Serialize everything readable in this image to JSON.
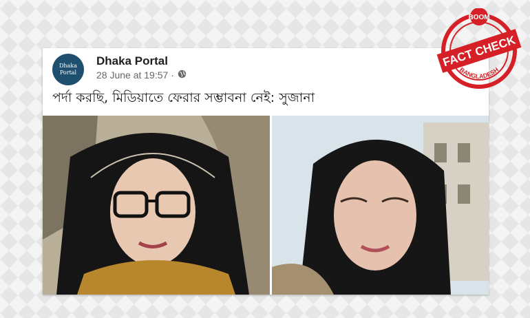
{
  "post": {
    "page_name": "Dhaka Portal",
    "timestamp": "28 June at 19:57 ·",
    "caption": "পর্দা করছি, মিডিয়াতে ফেরার সম্ভাবনা নেই: সুজানা",
    "avatar_text_line1": "Dhaka",
    "avatar_text_line2": "Portal",
    "privacy_icon": "globe-icon"
  },
  "watermark": {
    "top": "BOOM",
    "middle": "FACT CHECK",
    "bottom": "BANGLADESH",
    "color": "#d62027"
  }
}
